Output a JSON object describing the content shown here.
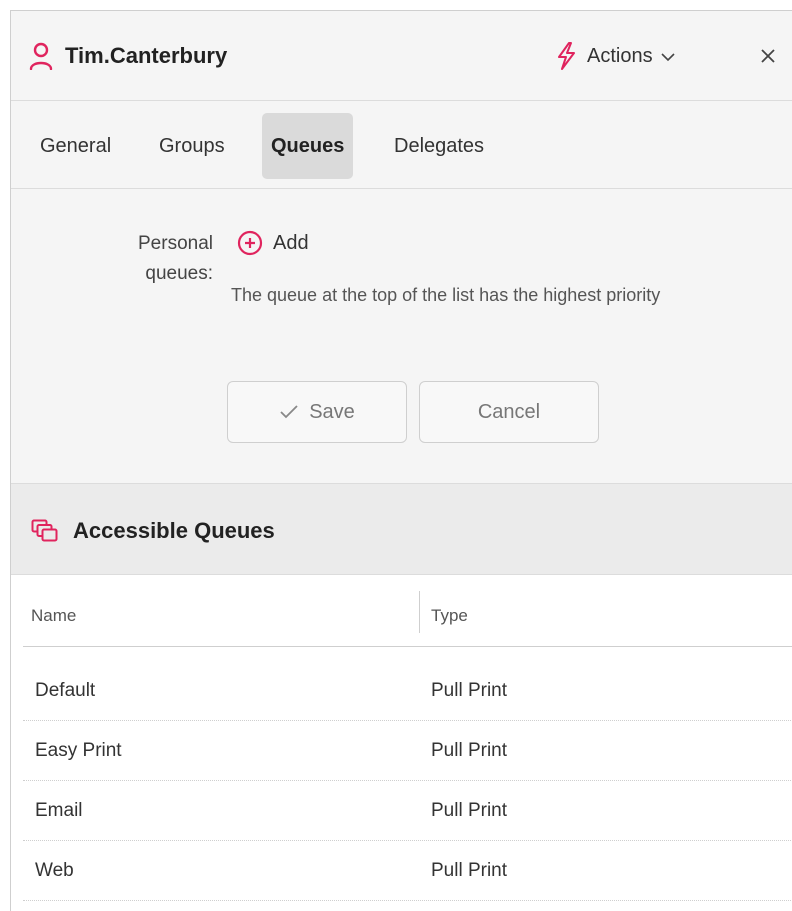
{
  "header": {
    "user_name": "Tim.Canterbury",
    "actions_label": "Actions",
    "accent_color": "#e0245e",
    "icons": [
      "user-icon",
      "bolt-icon",
      "chevron-down-icon",
      "close-icon"
    ]
  },
  "tabs": [
    {
      "label": "General",
      "active": false
    },
    {
      "label": "Groups",
      "active": false
    },
    {
      "label": "Queues",
      "active": true
    },
    {
      "label": "Delegates",
      "active": false
    }
  ],
  "personal_queues": {
    "label_line1": "Personal",
    "label_line2": "queues:",
    "add_label": "Add",
    "help_text": "The queue at the top of the list has the highest priority",
    "save_label": "Save",
    "cancel_label": "Cancel"
  },
  "accessible_queues": {
    "title": "Accessible Queues",
    "columns": [
      "Name",
      "Type"
    ],
    "rows": [
      {
        "name": "Default",
        "type": "Pull Print"
      },
      {
        "name": "Easy Print",
        "type": "Pull Print"
      },
      {
        "name": "Email",
        "type": "Pull Print"
      },
      {
        "name": "Web",
        "type": "Pull Print"
      }
    ]
  }
}
